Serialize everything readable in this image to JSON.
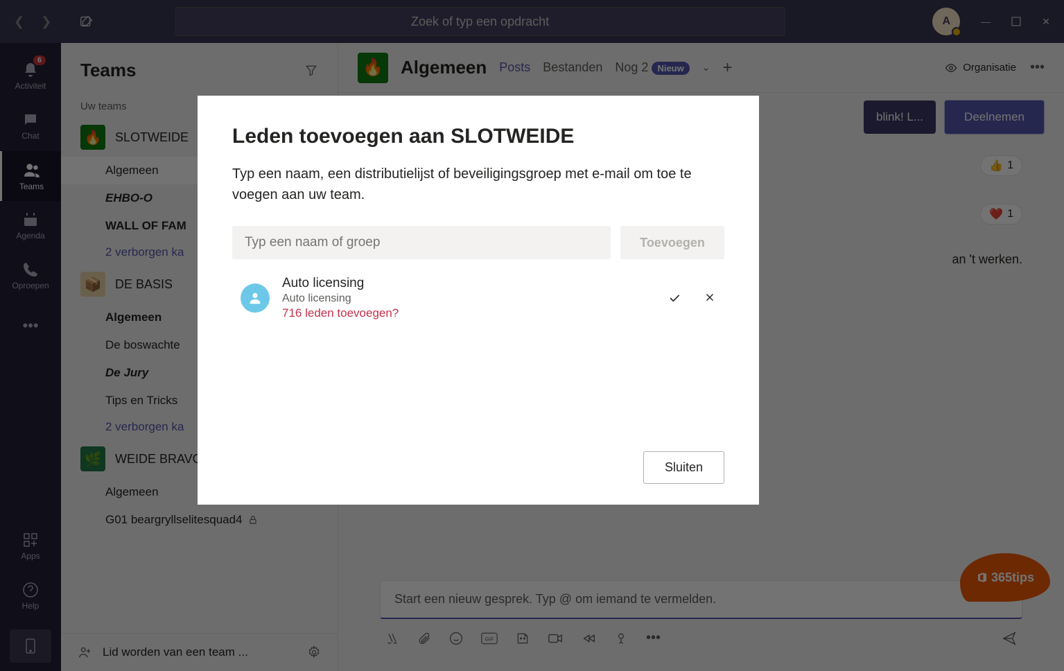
{
  "titlebar": {
    "search_placeholder": "Zoek of typ een opdracht",
    "avatar_letter": "A"
  },
  "nav": {
    "activity": {
      "label": "Activiteit",
      "badge": "6"
    },
    "chat": {
      "label": "Chat"
    },
    "teams": {
      "label": "Teams"
    },
    "calendar": {
      "label": "Agenda"
    },
    "calls": {
      "label": "Oproepen"
    },
    "apps": {
      "label": "Apps"
    },
    "help": {
      "label": "Help"
    }
  },
  "teams_panel": {
    "title": "Teams",
    "your_teams": "Uw teams",
    "teams": [
      {
        "name": "SLOTWEIDE",
        "channels": [
          {
            "label": "Algemeen",
            "selected": true
          },
          {
            "label": "EHBO-O",
            "italic": true
          },
          {
            "label": "WALL OF FAM",
            "bold": true
          }
        ],
        "hidden": "2 verborgen ka"
      },
      {
        "name": "DE BASIS",
        "channels": [
          {
            "label": "Algemeen",
            "bold": true
          },
          {
            "label": "De boswachte"
          },
          {
            "label": "De Jury",
            "italic": true
          },
          {
            "label": "Tips en Tricks"
          }
        ],
        "hidden": "2 verborgen ka"
      },
      {
        "name": "WEIDE BRAVO",
        "channels": [
          {
            "label": "Algemeen"
          },
          {
            "label": "G01 beargryllselitesquad4",
            "locked": true
          }
        ]
      }
    ],
    "join_team": "Lid worden van een team ..."
  },
  "channel_header": {
    "title": "Algemeen",
    "tabs": {
      "posts": "Posts",
      "files": "Bestanden",
      "more": "Nog 2",
      "badge": "Nieuw"
    },
    "organization": "Organisatie"
  },
  "meeting": {
    "chip": "blink! L...",
    "join": "Deelnemen"
  },
  "reactions": {
    "thumb_count": "1",
    "heart_count": "1"
  },
  "message_fragment": "an 't werken.",
  "compose": {
    "placeholder": "Start een nieuw gesprek. Typ @ om iemand te vermelden."
  },
  "modal": {
    "title": "Leden toevoegen aan SLOTWEIDE",
    "subtitle": "Typ een naam, een distributielijst of beveiligingsgroep met e-mail om toe te voegen aan uw team.",
    "input_placeholder": "Typ een naam of groep",
    "add_button": "Toevoegen",
    "suggestion": {
      "name": "Auto licensing",
      "desc": "Auto licensing",
      "warn": "716 leden toevoegen?"
    },
    "close": "Sluiten"
  },
  "brand": "365tips"
}
